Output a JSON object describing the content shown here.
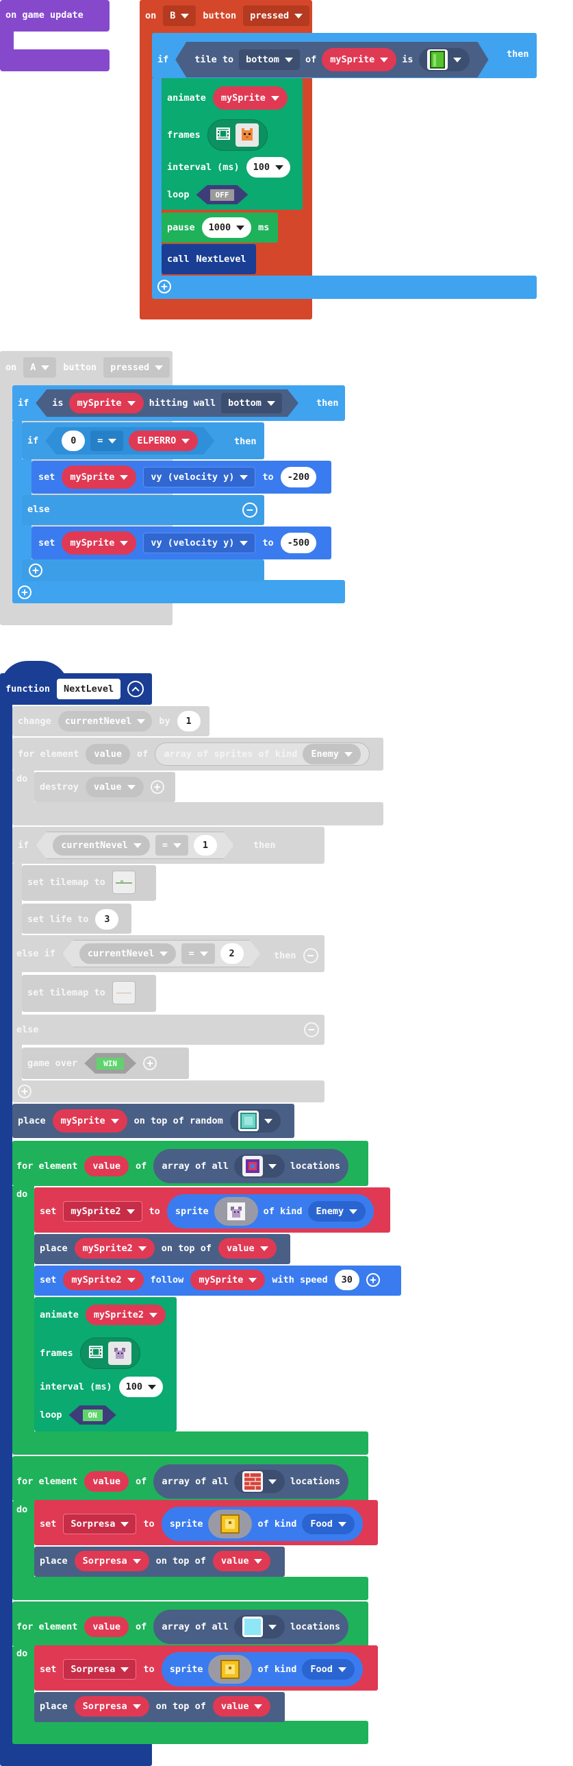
{
  "colors": {
    "events": "#d4472a",
    "logic": "#3fa3ef",
    "animation": "#0aaa70",
    "loops": "#1fb25a",
    "functions": "#1a3e94",
    "game": "#8649cc",
    "sprites": "#4a5f85",
    "variables": "#e03954",
    "disabled": "#d6d6d6"
  },
  "on_game_update": {
    "label": "on game update"
  },
  "b_button": {
    "on": "on",
    "button_name": "B",
    "button": "button",
    "event": "pressed",
    "if": "if",
    "tile_to": "tile to",
    "direction": "bottom",
    "of": "of",
    "sprite": "mySprite",
    "is": "is",
    "then": "then",
    "tile_icon": "green-pipe-tile",
    "animate": "animate",
    "animate_sprite": "mySprite",
    "frames": "frames",
    "frames_icon": "orange-cat-sprite",
    "interval": "interval (ms)",
    "interval_val": "100",
    "loop": "loop",
    "loop_val": "OFF",
    "pause": "pause",
    "pause_val": "1000",
    "ms": "ms",
    "call": "call",
    "call_fn": "NextLevel"
  },
  "a_button": {
    "on": "on",
    "button_name": "A",
    "button": "button",
    "event": "pressed",
    "if1": "if",
    "is": "is",
    "sprite": "mySprite",
    "hitting_wall": "hitting wall",
    "wall_dir": "bottom",
    "then1": "then",
    "if2": "if",
    "left_val": "0",
    "op": "=",
    "var": "ELPERRO",
    "then2": "then",
    "set1": "set",
    "set1_sprite": "mySprite",
    "prop": "vy (velocity y)",
    "to1": "to",
    "val1": "-200",
    "else": "else",
    "set2": "set",
    "set2_sprite": "mySprite",
    "prop2": "vy (velocity y)",
    "to2": "to",
    "val2": "-500"
  },
  "function_block": {
    "function": "function",
    "name": "NextLevel",
    "change": "change",
    "change_var": "currentNevel",
    "by": "by",
    "by_val": "1",
    "for1": "for element",
    "for1_var": "value",
    "of": "of",
    "array_sprites": "array of sprites of kind",
    "kind1": "Enemy",
    "do": "do",
    "destroy": "destroy",
    "destroy_var": "value",
    "if": "if",
    "cond_var": "currentNevel",
    "cond_op": "=",
    "cond_val": "1",
    "then": "then",
    "set_tilemap": "set tilemap to",
    "set_life": "set life to",
    "life_val": "3",
    "else_if": "else if",
    "cond2_var": "currentNevel",
    "cond2_op": "=",
    "cond2_val": "2",
    "then2": "then",
    "set_tilemap2": "set tilemap to",
    "else": "else",
    "game_over": "game over",
    "win": "WIN",
    "place": "place",
    "place_sprite": "mySprite",
    "on_top_random": "on top of random",
    "for2": "for element",
    "for2_var": "value",
    "array_all": "array of all",
    "locations": "locations",
    "set_s2": "set",
    "s2": "mySprite2",
    "to": "to",
    "sprite_kw": "sprite",
    "of_kind": "of kind",
    "kind_enemy": "Enemy",
    "place2": "place",
    "place2_sprite": "mySprite2",
    "on_top_of": "on top of",
    "place2_var": "value",
    "set_follow": "set",
    "follow_sprite": "mySprite2",
    "follow": "follow",
    "follow_target": "mySprite",
    "with_speed": "with speed",
    "speed_val": "30",
    "animate": "animate",
    "animate_sprite": "mySprite2",
    "frames": "frames",
    "interval": "interval (ms)",
    "interval_val": "100",
    "loop": "loop",
    "loop_val": "ON",
    "for3": "for element",
    "for3_var": "value",
    "array_all3": "array of all",
    "locations3": "locations",
    "set_s3": "set",
    "s3": "Sorpresa",
    "to3": "to",
    "sprite_kw3": "sprite",
    "of_kind3": "of kind",
    "kind_food": "Food",
    "place3": "place",
    "place3_sprite": "Sorpresa",
    "on_top_of3": "on top of",
    "place3_var": "value",
    "for4": "for element",
    "for4_var": "value",
    "array_all4": "array of all",
    "locations4": "locations",
    "set_s4": "set",
    "s4": "Sorpresa",
    "to4": "to",
    "sprite_kw4": "sprite",
    "of_kind4": "of kind",
    "kind_food4": "Food",
    "place4": "place",
    "place4_sprite": "Sorpresa",
    "on_top_of4": "on top of",
    "place4_var": "value"
  }
}
